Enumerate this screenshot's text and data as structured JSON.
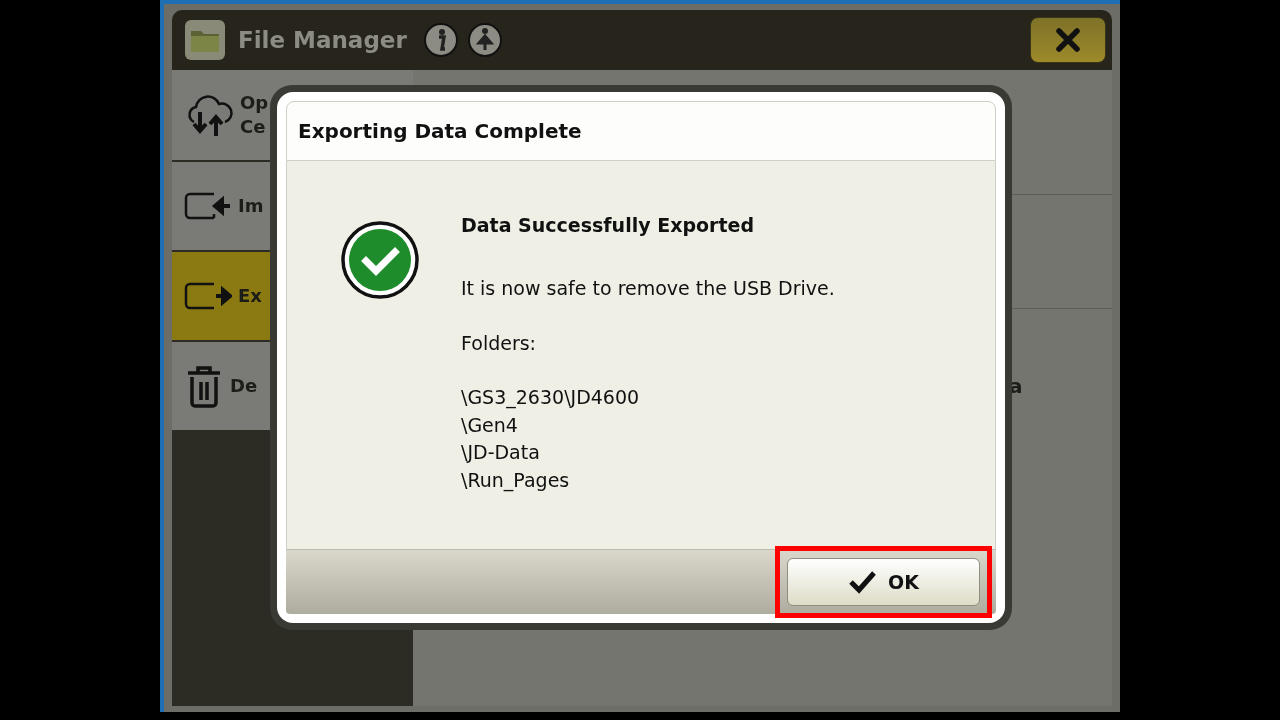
{
  "window": {
    "title": "File Manager"
  },
  "sidebar": {
    "items": [
      {
        "kind": "cloud",
        "lines": [
          "Op",
          "Ce"
        ],
        "selected": false
      },
      {
        "kind": "import",
        "lines": [
          "Im"
        ],
        "selected": false
      },
      {
        "kind": "export",
        "lines": [
          "Ex"
        ],
        "selected": true
      },
      {
        "kind": "delete",
        "lines": [
          "De"
        ],
        "selected": false
      }
    ]
  },
  "content": {
    "fragment": "a"
  },
  "dialog": {
    "title": "Exporting Data Complete",
    "heading": "Data Successfully Exported",
    "message": "It is now safe to remove the USB Drive.",
    "folders_label": "Folders:",
    "folders": [
      "\\GS3_2630\\JD4600",
      "\\Gen4",
      "\\JD-Data",
      "\\Run_Pages"
    ],
    "ok_button": "OK"
  }
}
